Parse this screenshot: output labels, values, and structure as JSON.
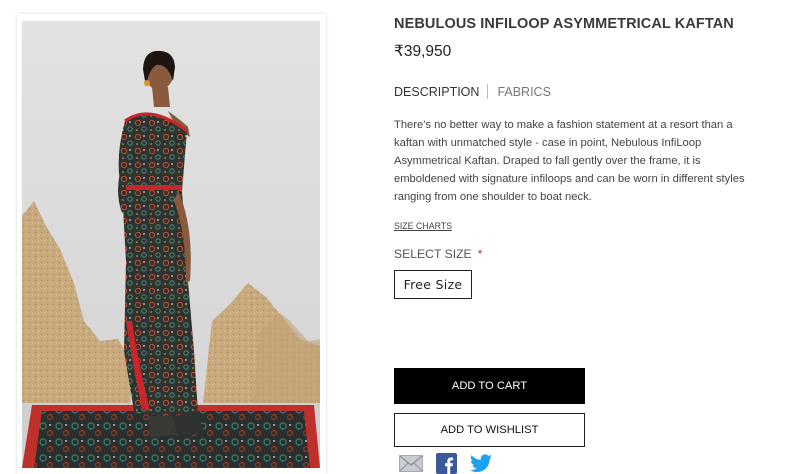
{
  "product": {
    "title": "NEBULOUS INFILOOP ASYMMETRICAL KAFTAN",
    "price": "₹39,950",
    "image_alt": "Model wearing Nebulous Infiloop Asymmetrical Kaftan"
  },
  "tabs": [
    {
      "label": "DESCRIPTION",
      "active": true
    },
    {
      "label": "FABRICS",
      "active": false
    }
  ],
  "description": "There's no better way to make a fashion statement at a resort than a kaftan with unmatched style - case in point, Nebulous InfiLoop Asymmetrical Kaftan. Draped to fall gently over the frame, it is emboldened with signature infiloops and can be worn in different styles ranging from one shoulder to boat neck.",
  "size_charts_label": "SIZE CHARTS",
  "select_size": {
    "label": "SELECT SIZE",
    "required_mark": "*",
    "options": [
      "Free Size"
    ]
  },
  "actions": {
    "add_to_cart": "ADD TO CART",
    "add_to_wishlist": "ADD TO WISHLIST"
  },
  "share_icons": [
    "email-icon",
    "facebook-icon",
    "twitter-icon"
  ],
  "colors": {
    "primary_button": "#000000",
    "required": "#d9302c",
    "facebook": "#3b5998",
    "twitter": "#1da1f2"
  }
}
